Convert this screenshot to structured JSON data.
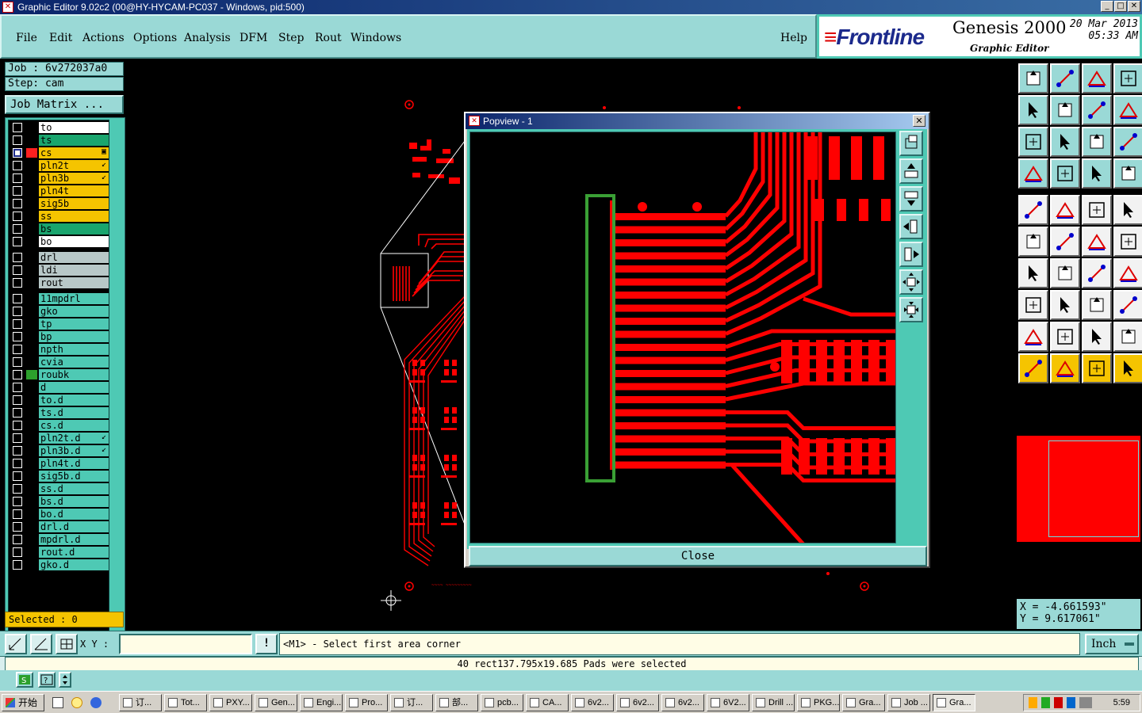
{
  "window": {
    "title": "Graphic Editor 9.02c2 (00@HY-HYCAM-PC037 - Windows, pid:500)",
    "minimize": "_",
    "maximize": "□",
    "close": "✕"
  },
  "menu": [
    "File",
    "Edit",
    "Actions",
    "Options",
    "Analysis",
    "DFM",
    "Step",
    "Rout",
    "Windows"
  ],
  "help": "Help",
  "brand": {
    "logo": "Frontline",
    "product": "Genesis 2000",
    "subtitle": "Graphic Editor",
    "date": "20 Mar 2013",
    "time": "05:33 AM"
  },
  "job": {
    "job_label": "Job : 6v272037a0",
    "step_label": "Step: cam",
    "matrix_button": "Job Matrix ..."
  },
  "layers": [
    {
      "name": "to",
      "color": "#ffffff",
      "group": 1
    },
    {
      "name": "ts",
      "color": "#1aa56e",
      "group": 1
    },
    {
      "name": "cs",
      "color": "#f5c400",
      "group": 1,
      "work": true,
      "mark": "▣"
    },
    {
      "name": "pln2t",
      "color": "#f5c400",
      "group": 1,
      "mark": "↙"
    },
    {
      "name": "pln3b",
      "color": "#f5c400",
      "group": 1,
      "mark": "↙"
    },
    {
      "name": "pln4t",
      "color": "#f5c400",
      "group": 1
    },
    {
      "name": "sig5b",
      "color": "#f5c400",
      "group": 1
    },
    {
      "name": "ss",
      "color": "#f5c400",
      "group": 1
    },
    {
      "name": "bs",
      "color": "#1aa56e",
      "group": 1
    },
    {
      "name": "bo",
      "color": "#ffffff",
      "group": 1
    },
    {
      "name": "drl",
      "color": "#b8c8c8",
      "group": 2
    },
    {
      "name": "ldi",
      "color": "#b8c8c8",
      "group": 2
    },
    {
      "name": "rout",
      "color": "#b8c8c8",
      "group": 2
    },
    {
      "name": "11mpdrl",
      "color": "#4ec9b4",
      "group": 3
    },
    {
      "name": "gko",
      "color": "#4ec9b4",
      "group": 3
    },
    {
      "name": "tp",
      "color": "#4ec9b4",
      "group": 3
    },
    {
      "name": "bp",
      "color": "#4ec9b4",
      "group": 3
    },
    {
      "name": "npth",
      "color": "#4ec9b4",
      "group": 3
    },
    {
      "name": "cvia",
      "color": "#4ec9b4",
      "group": 3
    },
    {
      "name": "roubk",
      "color": "#4ec9b4",
      "group": 3,
      "display": "#2ca02c"
    },
    {
      "name": "d",
      "color": "#4ec9b4",
      "group": 3
    },
    {
      "name": "to.d",
      "color": "#4ec9b4",
      "group": 3
    },
    {
      "name": "ts.d",
      "color": "#4ec9b4",
      "group": 3
    },
    {
      "name": "cs.d",
      "color": "#4ec9b4",
      "group": 3
    },
    {
      "name": "pln2t.d",
      "color": "#4ec9b4",
      "group": 3,
      "mark": "↙"
    },
    {
      "name": "pln3b.d",
      "color": "#4ec9b4",
      "group": 3,
      "mark": "↙"
    },
    {
      "name": "pln4t.d",
      "color": "#4ec9b4",
      "group": 3
    },
    {
      "name": "sig5b.d",
      "color": "#4ec9b4",
      "group": 3
    },
    {
      "name": "ss.d",
      "color": "#4ec9b4",
      "group": 3
    },
    {
      "name": "bs.d",
      "color": "#4ec9b4",
      "group": 3
    },
    {
      "name": "bo.d",
      "color": "#4ec9b4",
      "group": 3
    },
    {
      "name": "drl.d",
      "color": "#4ec9b4",
      "group": 3
    },
    {
      "name": "mpdrl.d",
      "color": "#4ec9b4",
      "group": 3
    },
    {
      "name": "rout.d",
      "color": "#4ec9b4",
      "group": 3
    },
    {
      "name": "gko.d",
      "color": "#4ec9b4",
      "group": 3
    }
  ],
  "selected_label": "Selected : 0",
  "popview": {
    "title": "Popview - 1",
    "close_x": "✕",
    "close_button": "Close"
  },
  "coords": {
    "x": "X = -4.661593\"",
    "y": "Y = 9.617061\""
  },
  "command": {
    "xy_label": "X Y :",
    "xy_value": "",
    "exclaim": "!",
    "prompt": "<M1> - Select first area corner",
    "units": "Inch",
    "status": "40 rect137.795x19.685 Pads were selected"
  },
  "taskbar": {
    "start": "开始",
    "items": [
      "订...",
      "Tot...",
      "PXY...",
      "Gen...",
      "Engi...",
      "Pro...",
      "订...",
      "部...",
      "pcb...",
      "CA...",
      "6v2...",
      "6v2...",
      "6v2...",
      "6V2...",
      "Drill ...",
      "PKG...",
      "Gra...",
      "Job ...",
      "Gra..."
    ],
    "clock": "5:59"
  },
  "colors": {
    "trace": "#ff0000",
    "ui_teal": "#9ad9d6",
    "ui_dark_teal": "#4ec9b4",
    "highlight": "#f5c400",
    "outline_green": "#3aa035"
  }
}
